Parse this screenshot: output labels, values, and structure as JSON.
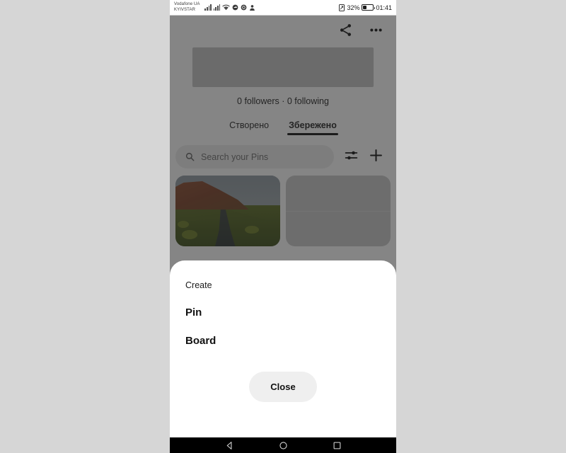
{
  "status_bar": {
    "carrier_line1": "Vodafone UA",
    "carrier_line2": "KYIVSTAR",
    "battery_percent": "32%",
    "time": "01:41",
    "icons": [
      "signal-bars-sim1-icon",
      "signal-bars-sim2-icon",
      "wifi-icon",
      "sync-icon",
      "alarm-icon",
      "bluetooth-share-icon",
      "nfc-icon",
      "battery-icon"
    ]
  },
  "app_bar": {
    "share_label": "share-icon",
    "more_label": "more-options-icon"
  },
  "profile": {
    "stats": "0 followers · 0 following"
  },
  "tabs": [
    {
      "label": "Створено",
      "active": false
    },
    {
      "label": "Збережено",
      "active": true
    }
  ],
  "search": {
    "placeholder": "Search your Pins",
    "icon": "search-icon",
    "filter_icon": "filter-sliders-icon",
    "add_icon": "plus-icon"
  },
  "grid": {
    "tiles": [
      {
        "type": "photo",
        "alt": "landscape-mesa-stream"
      },
      {
        "type": "placeholder",
        "alt": "empty-board-tile"
      }
    ]
  },
  "sheet": {
    "title": "Create",
    "options": [
      {
        "label": "Pin"
      },
      {
        "label": "Board"
      }
    ],
    "close_label": "Close"
  },
  "nav_bar": {
    "back": "back-icon",
    "home": "home-icon",
    "recents": "recents-icon"
  },
  "colors": {
    "scrim": "#767676",
    "sheet_bg": "#ffffff",
    "close_btn_bg": "#efefef",
    "desktop_bg": "#d6d6d6",
    "nav_bg": "#000000"
  }
}
